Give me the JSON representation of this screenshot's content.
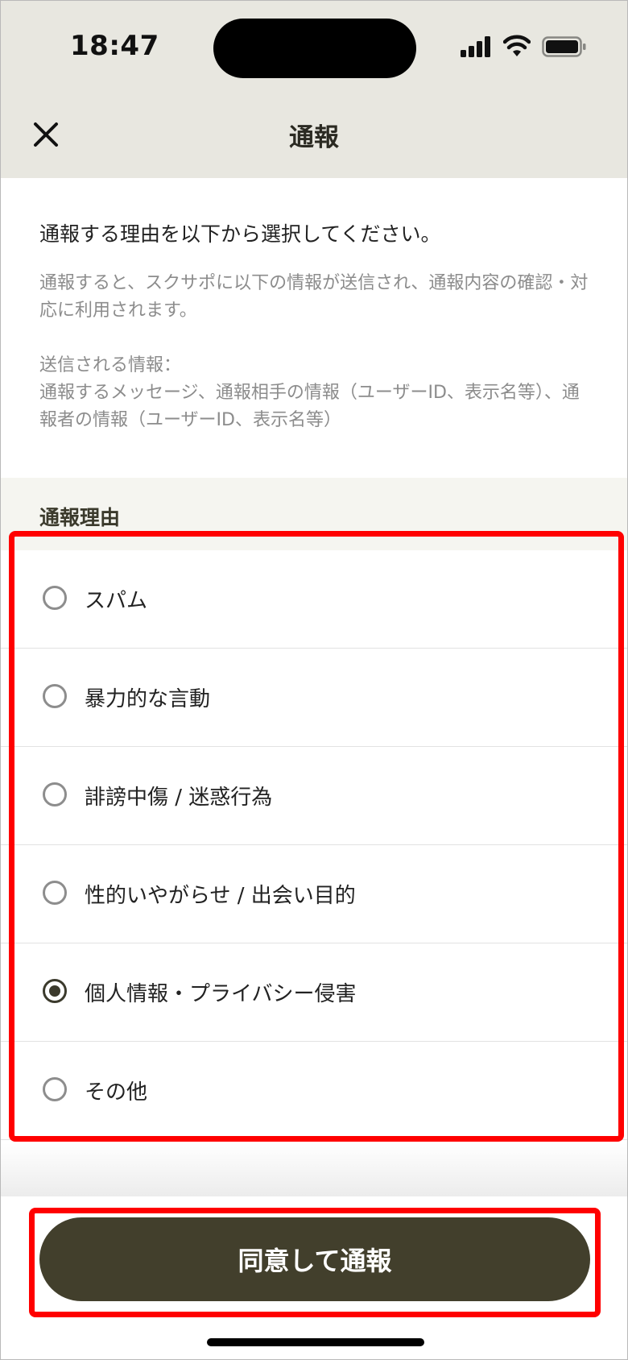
{
  "status_bar": {
    "time": "18:47",
    "icons": [
      "signal-icon",
      "wifi-icon",
      "battery-icon"
    ]
  },
  "header": {
    "title": "通報",
    "close_icon": "close-icon"
  },
  "intro": {
    "heading": "通報する理由を以下から選択してください。",
    "note": "通報すると、スクサポに以下の情報が送信され、通報内容の確認・対応に利用されます。",
    "info_label": "送信される情報：",
    "info_text": "通報するメッセージ、通報相手の情報（ユーザーID、表示名等）、通報者の情報（ユーザーID、表示名等）"
  },
  "reasons": {
    "title": "通報理由",
    "options": [
      {
        "label": "スパム",
        "selected": false
      },
      {
        "label": "暴力的な言動",
        "selected": false
      },
      {
        "label": "誹謗中傷 / 迷惑行為",
        "selected": false
      },
      {
        "label": "性的いやがらせ / 出会い目的",
        "selected": false
      },
      {
        "label": "個人情報・プライバシー侵害",
        "selected": true
      },
      {
        "label": "その他",
        "selected": false
      }
    ]
  },
  "submit": {
    "label": "同意して通報"
  },
  "colors": {
    "header_bg": "#e8e7e0",
    "accent": "#423f2c",
    "highlight": "#ff0000",
    "muted_text": "#8c8c8c"
  }
}
